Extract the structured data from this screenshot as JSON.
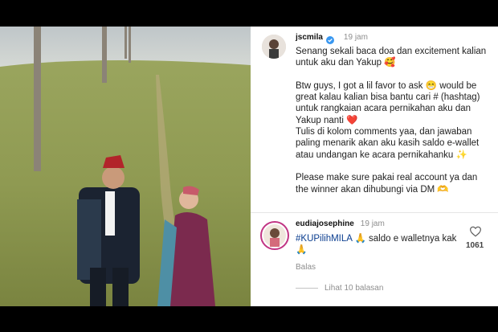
{
  "post": {
    "username": "jscmila",
    "verified": true,
    "time": "19 jam",
    "caption": "Senang sekali baca doa dan excitement kalian untuk aku dan Yakup 🥰\n\nBtw guys, I got a lil favor to ask 😁 would be great kalau kalian bisa bantu cari # (hashtag) untuk rangkaian acara pernikahan aku dan Yakup nanti ❤️\nTulis di kolom comments yaa, dan jawaban paling menarik akan aku kasih saldo e-wallet atau undangan ke acara pernikahanku ✨\n\nPlease make sure pakai real account ya dan the winner akan dihubungi via DM 🫶"
  },
  "comment": {
    "username": "eudiajosephine",
    "time": "19 jam",
    "hashtag": "#KUPilihMILA",
    "text": " 🙏 saldo e walletnya kak 🙏",
    "reply_label": "Balas",
    "like_count": "1061",
    "view_replies": "Lihat 10 balasan"
  },
  "icons": {
    "verified": "verified-badge-icon",
    "like": "heart-outline-icon"
  },
  "colors": {
    "verified": "#3897f0",
    "hashtag": "#0a3d8f",
    "muted": "#8e8e8e",
    "story_ring": "#c13584"
  }
}
